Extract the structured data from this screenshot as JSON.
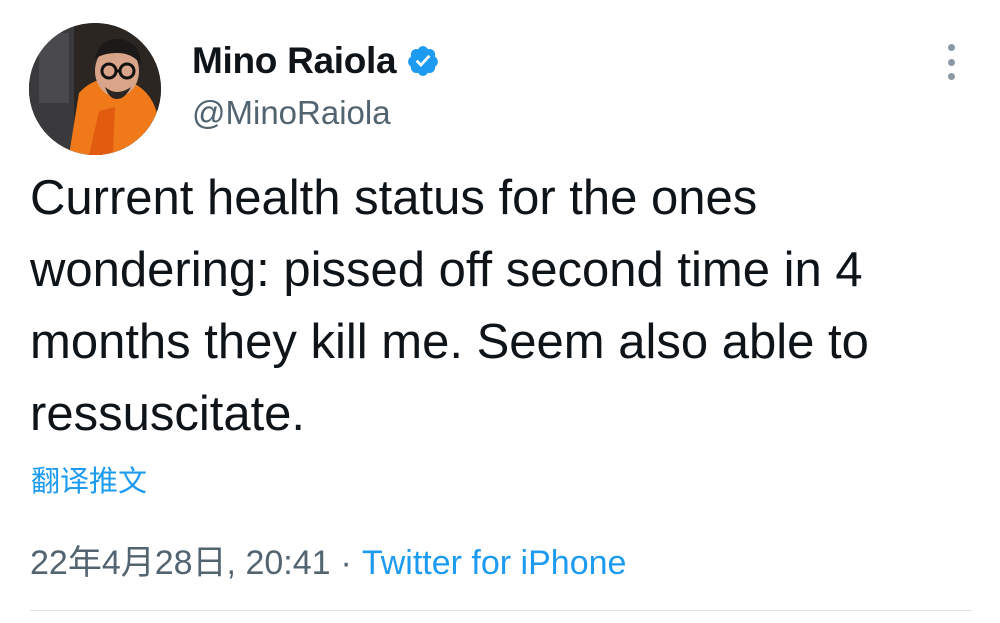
{
  "author": {
    "display_name": "Mino Raiola",
    "handle": "@MinoRaiola",
    "verified": true
  },
  "tweet": {
    "text": "Current health status for the ones wondering: pissed off second time in 4 months they kill me. Seem also able to ressuscitate.",
    "translate_label": "翻译推文",
    "timestamp": "22年4月28日, 20:41",
    "separator": "·",
    "source": "Twitter for iPhone"
  },
  "icons": {
    "verified": "verified-badge-icon",
    "more": "more-options-icon"
  },
  "colors": {
    "link": "#1d9bf0",
    "secondary_text": "#536471",
    "primary_text": "#0f1419"
  }
}
